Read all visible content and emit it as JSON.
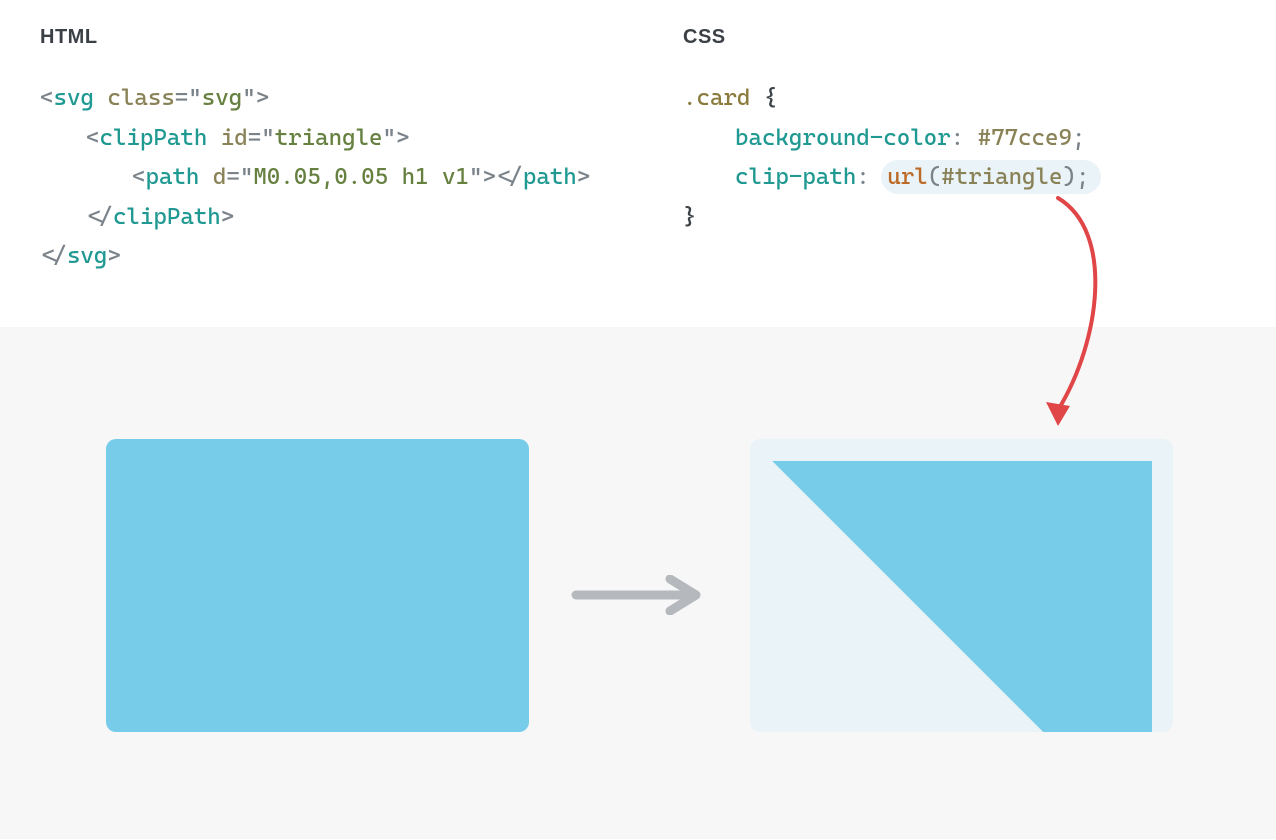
{
  "headers": {
    "html": "HTML",
    "css": "CSS"
  },
  "html_code": {
    "line1": {
      "open": "<",
      "tag": "svg",
      "sp": " ",
      "attr": "class",
      "eq": "=",
      "q1": "\"",
      "val": "svg",
      "q2": "\"",
      "close": ">"
    },
    "line2": {
      "open": "<",
      "tag": "clipPath",
      "sp": " ",
      "attr": "id",
      "eq": "=",
      "q1": "\"",
      "val": "triangle",
      "q2": "\"",
      "close": ">"
    },
    "line3": {
      "open": "<",
      "tag": "path",
      "sp": " ",
      "attr": "d",
      "eq": "=",
      "q1": "\"",
      "val": "M0.05,0.05 h1 v1",
      "q2": "\"",
      "close1": ">",
      "open2": "</",
      "tag2": "path",
      "close2": ">"
    },
    "line4": {
      "open": "</",
      "tag": "clipPath",
      "close": ">"
    },
    "line5": {
      "open": "</",
      "tag": "svg",
      "close": ">"
    }
  },
  "css_code": {
    "line1": {
      "sel": ".card",
      "sp": " ",
      "brace": "{"
    },
    "line2": {
      "prop": "background-color",
      "colon": ":",
      "sp": " ",
      "val": "#77cce9",
      "semi": ";"
    },
    "line3": {
      "prop": "clip-path",
      "colon": ":",
      "sp": " ",
      "fn": "url",
      "lp": "(",
      "arg": "#triangle",
      "rp": ")",
      "semi": ";"
    },
    "line4": {
      "brace": "}"
    }
  },
  "colors": {
    "card_bg": "#77cce9",
    "illus_bg": "#f7f7f7",
    "after_bg": "#eaf3f7",
    "arrow_gray": "#b5b9bd",
    "arrow_red": "#e04648"
  }
}
